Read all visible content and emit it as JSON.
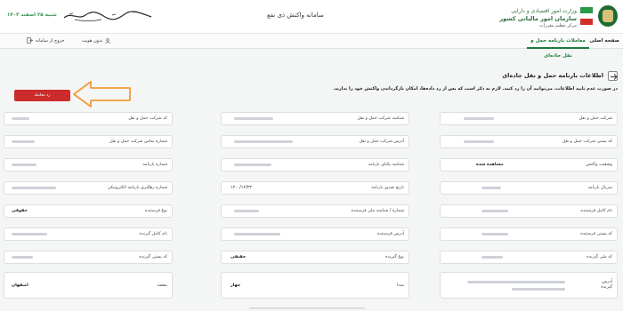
{
  "header": {
    "org_line1": "وزارت امور اقتصادی و دارایی",
    "org_line2": "سازمان امور مالیاتی کشور",
    "org_line3": "مرکز تنظیم مقررات",
    "system_title": "سامانه واکنش ذی نفع",
    "date": "شنبه ۲۵ اسفند ۱۴۰۳"
  },
  "nav": {
    "home": "صفحه اصلی",
    "active_tab": "معاملات بارنامه حمل و نقل جاده‌ای",
    "user": "بدون هویت",
    "exit": "خروج از سامانه"
  },
  "section": {
    "title": "اطلاعات بارنامه حمل و نقل جاده‌ای",
    "notice": "در صورت عدم تایید اطلاعات، می‌توانید آن را رد کنید. لازم به ذکر است که پس از رد داده‌ها، امکان بازگرداندن واکنش خود را ندارید.",
    "reject_label": "رد معامله"
  },
  "fields": {
    "r1c1": {
      "label": "شرکت حمل و نقل",
      "value": ""
    },
    "r1c2": {
      "label": "شناسه شرکت حمل و نقل",
      "value": ""
    },
    "r1c3": {
      "label": "کد شرکت حمل و نقل",
      "value": ""
    },
    "r2c1": {
      "label": "کد پستی شرکت حمل و نقل",
      "value": ""
    },
    "r2c2": {
      "label": "آدرس شرکت حمل و نقل",
      "value": ""
    },
    "r2c3": {
      "label": "شماره تماس شرکت حمل و نقل",
      "value": ""
    },
    "r3c1": {
      "label": "وضعیت واکنش",
      "value": "مشاهده شده"
    },
    "r3c2": {
      "label": "شناسه یکتای بارنامه",
      "value": ""
    },
    "r3c3": {
      "label": "شماره بارنامه",
      "value": ""
    },
    "r4c1": {
      "label": "سریال بارنامه",
      "value": ""
    },
    "r4c2": {
      "label": "تاریخ صدور بارنامه",
      "value": "۱۴۰۰/۱۲/۲۳"
    },
    "r4c3": {
      "label": "شماره رهگیری بارنامه الکترونیکی",
      "value": ""
    },
    "r5c1": {
      "label": "نام کامل فرستنده",
      "value": ""
    },
    "r5c2": {
      "label": "شماره / شناسه ملی فرستنده",
      "value": ""
    },
    "r5c3": {
      "label": "نوع فرستنده",
      "value": "حقوقی"
    },
    "r6c1": {
      "label": "کد پستی فرستنده",
      "value": ""
    },
    "r6c2": {
      "label": "آدرس فرستنده",
      "value": ""
    },
    "r6c3": {
      "label": "نام کامل گیرنده",
      "value": ""
    },
    "r7c1": {
      "label": "کد ملی گیرنده",
      "value": ""
    },
    "r7c2": {
      "label": "نوع گیرنده",
      "value": "حقیقی"
    },
    "r7c3": {
      "label": "کد پستی گیرنده",
      "value": ""
    },
    "r8c1": {
      "label": "آدرس گیرنده",
      "value": ""
    },
    "r8c2": {
      "label": "مبدا",
      "value": "چهار"
    },
    "r8c3": {
      "label": "مقصد",
      "value": "اصفهان"
    }
  },
  "colors": {
    "brand_green": "#1d7a3c",
    "reject_red": "#cc2b2b",
    "annotation_orange": "#f29a3a"
  }
}
